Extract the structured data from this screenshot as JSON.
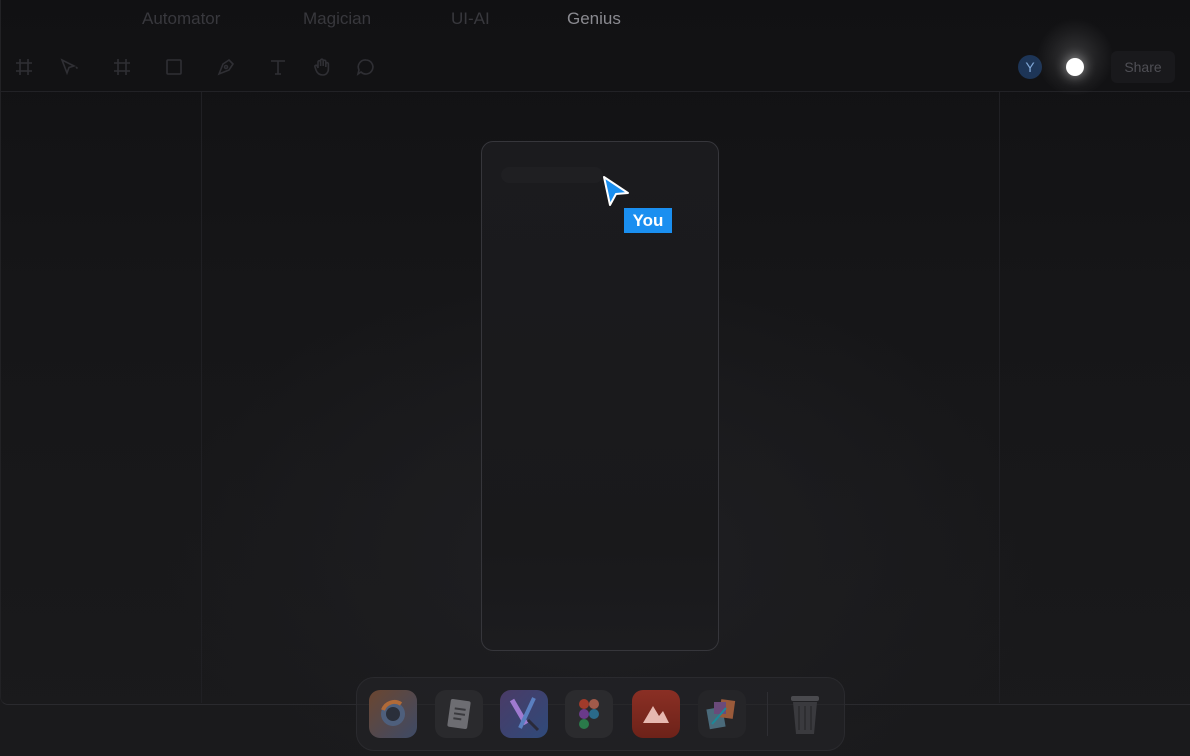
{
  "tabs": [
    {
      "label": "",
      "active": false
    },
    {
      "label": "Automator",
      "active": false
    },
    {
      "label": "Magician",
      "active": false
    },
    {
      "label": "UI-AI",
      "active": false
    },
    {
      "label": "Genius",
      "active": true
    }
  ],
  "toolbar": {
    "tools": [
      "frame-grid-icon",
      "move-pointer-icon",
      "frame-icon",
      "rectangle-icon",
      "pen-icon",
      "text-icon",
      "hand-icon",
      "comment-icon"
    ],
    "avatar_initial": "Y",
    "share_label": "Share"
  },
  "canvas": {
    "cursor_label": "You",
    "cursor_color": "#1a8ff0"
  },
  "dock": {
    "apps": [
      "browser-app-icon",
      "notes-app-icon",
      "design-app-icon",
      "figma-app-icon",
      "delta-app-icon",
      "collage-app-icon",
      "trash-icon"
    ]
  },
  "colors": {
    "background": "#141416",
    "accent": "#1a8ff0",
    "active_tab_text": "#8a8a90"
  }
}
